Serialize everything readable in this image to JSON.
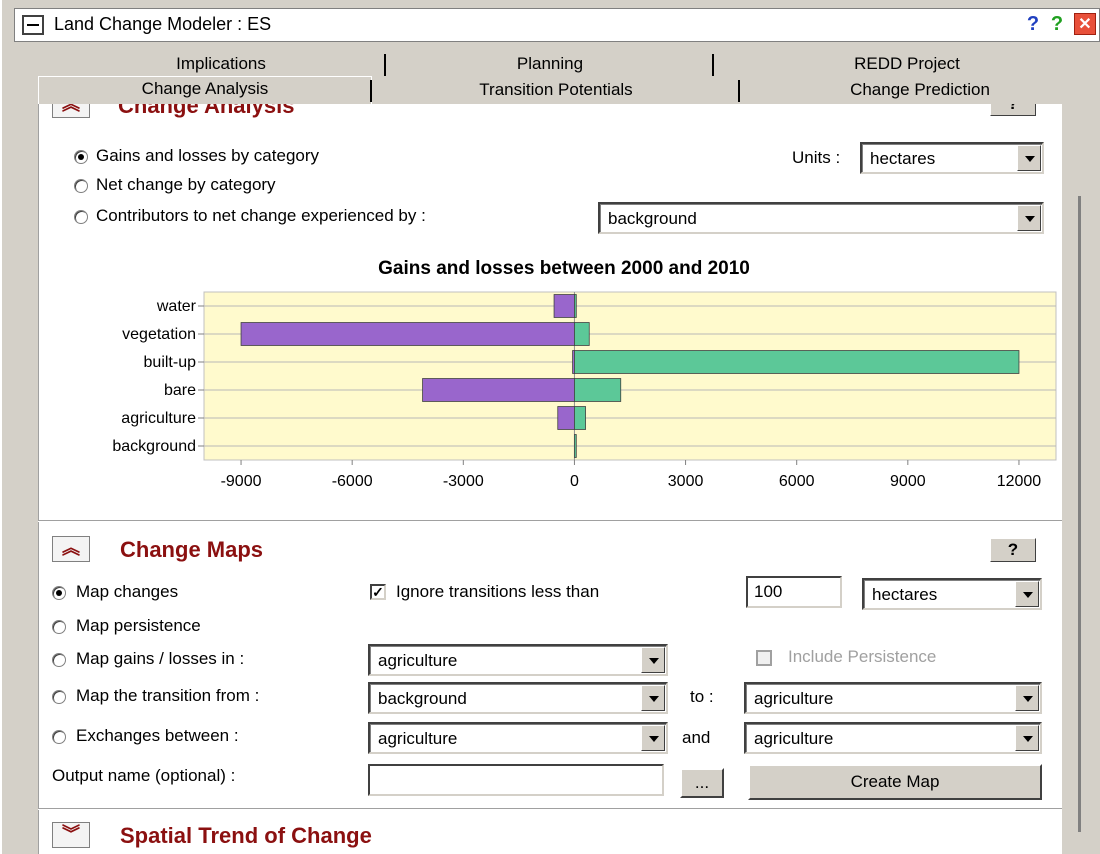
{
  "window": {
    "title": "Land Change Modeler : ES",
    "help_icons": [
      "?",
      "?"
    ],
    "close_label": "✕"
  },
  "tabs": {
    "row1": [
      "Implications",
      "Planning",
      "REDD Project"
    ],
    "row2": [
      "Change Analysis",
      "Transition Potentials",
      "Change Prediction"
    ]
  },
  "change_analysis": {
    "section_title": "Change Analysis",
    "options": [
      {
        "label": "Gains and losses by category",
        "selected": true
      },
      {
        "label": "Net change by category",
        "selected": false
      },
      {
        "label": "Contributors to net change experienced by :",
        "selected": false
      }
    ],
    "units_label": "Units :",
    "units_value": "hectares",
    "contributor_value": "background"
  },
  "chart_data": {
    "type": "bar",
    "title": "Gains and losses between 2000 and 2010",
    "categories": [
      "water",
      "vegetation",
      "built-up",
      "bare",
      "agriculture",
      "background"
    ],
    "series": [
      {
        "values": [
          -550,
          -9000,
          -50,
          -4100,
          -450,
          0
        ],
        "color": "#9966cc"
      },
      {
        "values": [
          50,
          400,
          12000,
          1250,
          300,
          50
        ],
        "color": "#5cc898"
      }
    ],
    "xticks": [
      "-9000",
      "-6000",
      "-3000",
      "0",
      "3000",
      "6000",
      "9000",
      "12000"
    ],
    "xlim": [
      -10000,
      13000
    ],
    "grid": true,
    "background": "#fffacd"
  },
  "change_maps": {
    "section_title": "Change Maps",
    "help": "?",
    "map_changes": "Map changes",
    "ignore_label": "Ignore transitions less than",
    "ignore_checked": true,
    "ignore_value": "100",
    "ignore_units": "hectares",
    "map_persistence": "Map persistence",
    "gains_label": "Map gains / losses in :",
    "gains_value": "agriculture",
    "include_persistence": "Include Persistence",
    "transition_label": "Map the transition from :",
    "transition_from": "background",
    "to_label": "to :",
    "transition_to": "agriculture",
    "exchanges_label": "Exchanges between :",
    "exchange_a": "agriculture",
    "and_label": "and",
    "exchange_b": "agriculture",
    "output_label": "Output name (optional) :",
    "output_value": "",
    "browse_label": "...",
    "create_label": "Create Map"
  },
  "spatial_trend": {
    "section_title": "Spatial Trend of Change"
  }
}
